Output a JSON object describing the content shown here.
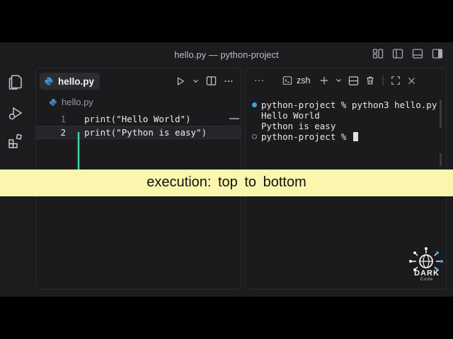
{
  "window": {
    "title": "hello.py — python-project"
  },
  "editor": {
    "tab_label": "hello.py",
    "breadcrumb": "hello.py",
    "lines": [
      {
        "number": "1",
        "fn": "print",
        "open": "(",
        "string": "\"Hello World\"",
        "close": ")"
      },
      {
        "number": "2",
        "fn": "print",
        "open": "(",
        "string": "\"Python is easy\"",
        "close": ")"
      }
    ]
  },
  "terminal": {
    "more_label": "···",
    "shell_label": "zsh",
    "lines": [
      {
        "text": "python-project % python3 hello.py"
      },
      {
        "text": "Hello World"
      },
      {
        "text": "Python is easy"
      },
      {
        "text": "python-project % "
      }
    ]
  },
  "banner": {
    "text": "execution:  top to bottom"
  },
  "logo": {
    "text": "DARK",
    "sub": "Code"
  },
  "colors": {
    "accent": "#3fa2d8",
    "arrow": "#3fd4a0",
    "banner": "#fbf6ae"
  }
}
